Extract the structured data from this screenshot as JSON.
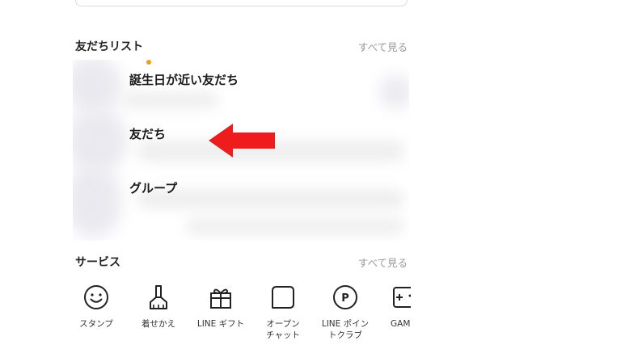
{
  "friends_section": {
    "title": "友だちリスト",
    "see_all": "すべて見る",
    "items": [
      {
        "label": "誕生日が近い友だち"
      },
      {
        "label": "友だち"
      },
      {
        "label": "グループ"
      }
    ]
  },
  "services_section": {
    "title": "サービス",
    "see_all": "すべて見る",
    "items": [
      {
        "label": "スタンプ",
        "icon": "smiley-icon"
      },
      {
        "label": "着せかえ",
        "icon": "brush-icon"
      },
      {
        "label": "LINE ギフト",
        "icon": "gift-icon"
      },
      {
        "label": "オープン\nチャット",
        "icon": "chat-icon"
      },
      {
        "label": "LINE ポイン\nトクラブ",
        "icon": "points-icon"
      },
      {
        "label": "GAM",
        "icon": "game-icon"
      }
    ]
  },
  "colors": {
    "arrow": "#ee1c1c",
    "badge": "#e8a11a",
    "muted_text": "#9a9a9a"
  }
}
